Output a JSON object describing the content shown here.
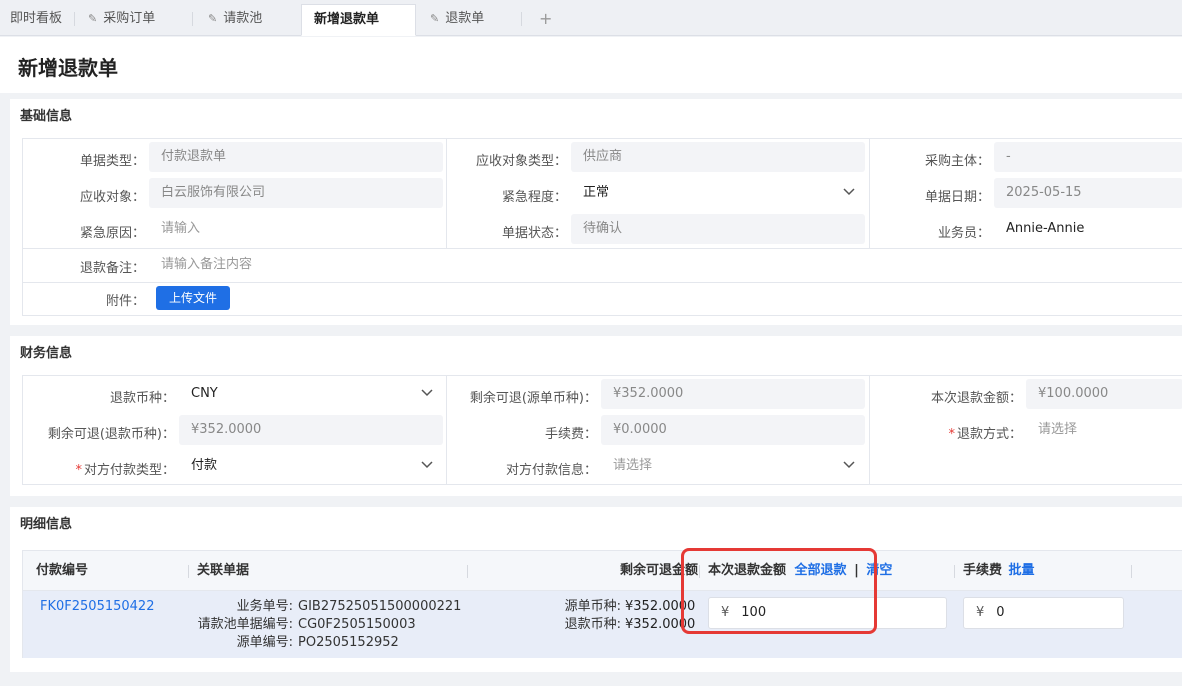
{
  "tabs": [
    {
      "label": "即时看板",
      "pinned": false,
      "active": false
    },
    {
      "label": "采购订单",
      "pinned": true,
      "active": false
    },
    {
      "label": "请款池",
      "pinned": true,
      "active": false
    },
    {
      "label": "新增退款单",
      "pinned": false,
      "active": true
    },
    {
      "label": "退款单",
      "pinned": true,
      "active": false
    }
  ],
  "tab_add": "+",
  "page_title": "新增退款单",
  "basic": {
    "title": "基础信息",
    "doc_type": {
      "label": "单据类型：",
      "value": "付款退款单"
    },
    "recv_type": {
      "label": "应收对象类型：",
      "value": "供应商"
    },
    "purchase_entity": {
      "label": "采购主体：",
      "value": "-"
    },
    "recv_obj": {
      "label": "应收对象：",
      "value": "白云服饰有限公司"
    },
    "urgency": {
      "label": "紧急程度：",
      "value": "正常"
    },
    "doc_date": {
      "label": "单据日期：",
      "value": "2025-05-15"
    },
    "urgent_reason": {
      "label": "紧急原因：",
      "placeholder": "请输入"
    },
    "doc_status": {
      "label": "单据状态：",
      "value": "待确认"
    },
    "salesman": {
      "label": "业务员：",
      "value": "Annie-Annie"
    },
    "remark": {
      "label": "退款备注：",
      "placeholder": "请输入备注内容"
    },
    "attachment": {
      "label": "附件：",
      "button": "上传文件"
    }
  },
  "finance": {
    "title": "财务信息",
    "currency": {
      "label": "退款币种：",
      "value": "CNY"
    },
    "remain_src": {
      "label": "剩余可退(源单币种)：",
      "value": "¥352.0000"
    },
    "refund_amount": {
      "label": "本次退款金额：",
      "value": "¥100.0000"
    },
    "remain_refund": {
      "label": "剩余可退(退款币种)：",
      "value": "¥352.0000"
    },
    "fee": {
      "label": "手续费：",
      "value": "¥0.0000"
    },
    "refund_method": {
      "label": "退款方式：",
      "placeholder": "请选择"
    },
    "pay_type": {
      "label": "对方付款类型：",
      "value": "付款"
    },
    "pay_info": {
      "label": "对方付款信息：",
      "placeholder": "请选择"
    }
  },
  "detail": {
    "title": "明细信息",
    "headers": {
      "pay_no": "付款编号",
      "related": "关联单据",
      "remain": "剩余可退金额",
      "refund_amount": "本次退款金额",
      "refund_all": "全部退款",
      "sep": "|",
      "clear": "清空",
      "fee": "手续费",
      "batch": "批量"
    },
    "row": {
      "pay_no": "FK0F2505150422",
      "biz_no_label": "业务单号:",
      "biz_no": "GIB27525051500000221",
      "pool_no_label": "请款池单据编号:",
      "pool_no": "CG0F2505150003",
      "src_no_label": "源单编号:",
      "src_no": "PO2505152952",
      "src_cur_label": "源单币种:",
      "src_cur_value": "¥352.0000",
      "refund_cur_label": "退款币种:",
      "refund_cur_value": "¥352.0000",
      "currency_symbol": "¥",
      "refund_amount": "100",
      "fee_symbol": "¥",
      "fee": "0"
    }
  },
  "colors": {
    "accent": "#1f6fe5",
    "highlight": "#e53935"
  }
}
